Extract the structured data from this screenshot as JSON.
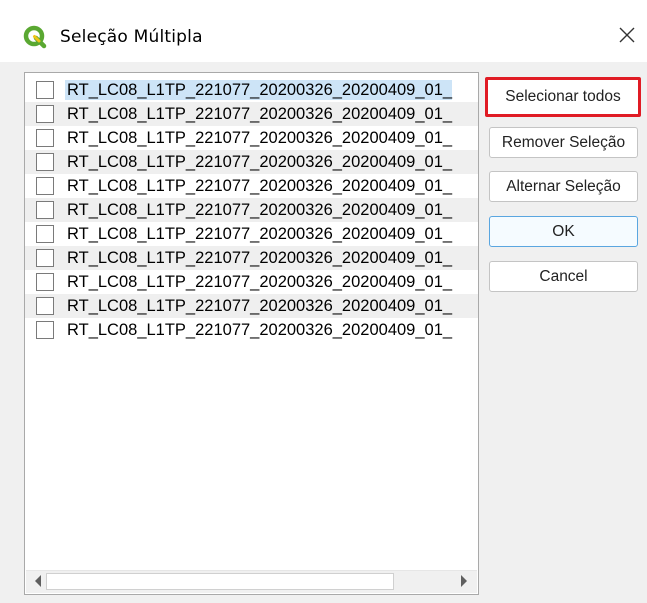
{
  "window": {
    "title": "Seleção Múltipla"
  },
  "list": {
    "items": [
      {
        "label": "RT_LC08_L1TP_221077_20200326_20200409_01_",
        "checked": false
      },
      {
        "label": "RT_LC08_L1TP_221077_20200326_20200409_01_",
        "checked": false
      },
      {
        "label": "RT_LC08_L1TP_221077_20200326_20200409_01_",
        "checked": false
      },
      {
        "label": "RT_LC08_L1TP_221077_20200326_20200409_01_",
        "checked": false
      },
      {
        "label": "RT_LC08_L1TP_221077_20200326_20200409_01_",
        "checked": false
      },
      {
        "label": "RT_LC08_L1TP_221077_20200326_20200409_01_",
        "checked": false
      },
      {
        "label": "RT_LC08_L1TP_221077_20200326_20200409_01_",
        "checked": false
      },
      {
        "label": "RT_LC08_L1TP_221077_20200326_20200409_01_",
        "checked": false
      },
      {
        "label": "RT_LC08_L1TP_221077_20200326_20200409_01_",
        "checked": false
      },
      {
        "label": "RT_LC08_L1TP_221077_20200326_20200409_01_",
        "checked": false
      },
      {
        "label": "RT_LC08_L1TP_221077_20200326_20200409_01_",
        "checked": false
      }
    ]
  },
  "buttons": {
    "select_all": "Selecionar todos",
    "remove_selection": "Remover Seleção",
    "toggle_selection": "Alternar Seleção",
    "ok": "OK",
    "cancel": "Cancel"
  },
  "icons": {
    "app": "qgis-icon",
    "close": "close-icon",
    "scroll_left": "arrow-left-icon",
    "scroll_right": "arrow-right-icon"
  },
  "colors": {
    "highlight_border": "#e01b24",
    "selection_bg": "#cde4f7",
    "default_button_border": "#5aa6e0",
    "qgis_green": "#5aa832",
    "qgis_yellow": "#f0c419"
  }
}
